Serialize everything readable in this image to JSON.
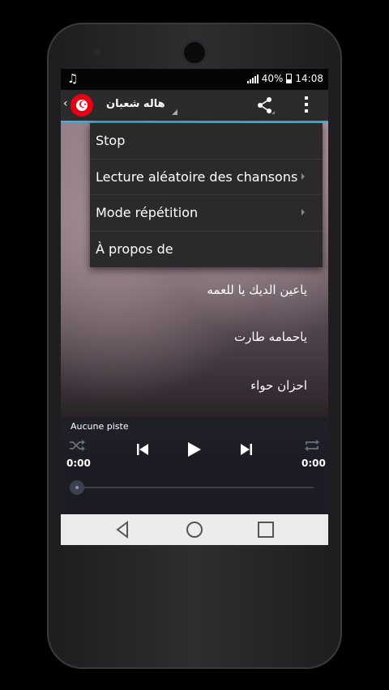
{
  "status_bar": {
    "signal": "40%",
    "time": "14:08"
  },
  "app_bar": {
    "title": "هاله شعبان"
  },
  "menu": {
    "items": [
      {
        "label": "Stop",
        "submenu": false
      },
      {
        "label": "Lecture aléatoire des chansons",
        "submenu": true
      },
      {
        "label": "Mode répétition",
        "submenu": true
      },
      {
        "label": "À propos de",
        "submenu": false
      }
    ]
  },
  "songs": [
    "ياعين الديك يا للعمه",
    "ياحمامه طارت",
    "احزان حواء"
  ],
  "player": {
    "track": "Aucune piste",
    "elapsed": "0:00",
    "duration": "0:00",
    "progress": 0
  },
  "colors": {
    "accent": "#33b5e5",
    "flag": "#e70013"
  }
}
